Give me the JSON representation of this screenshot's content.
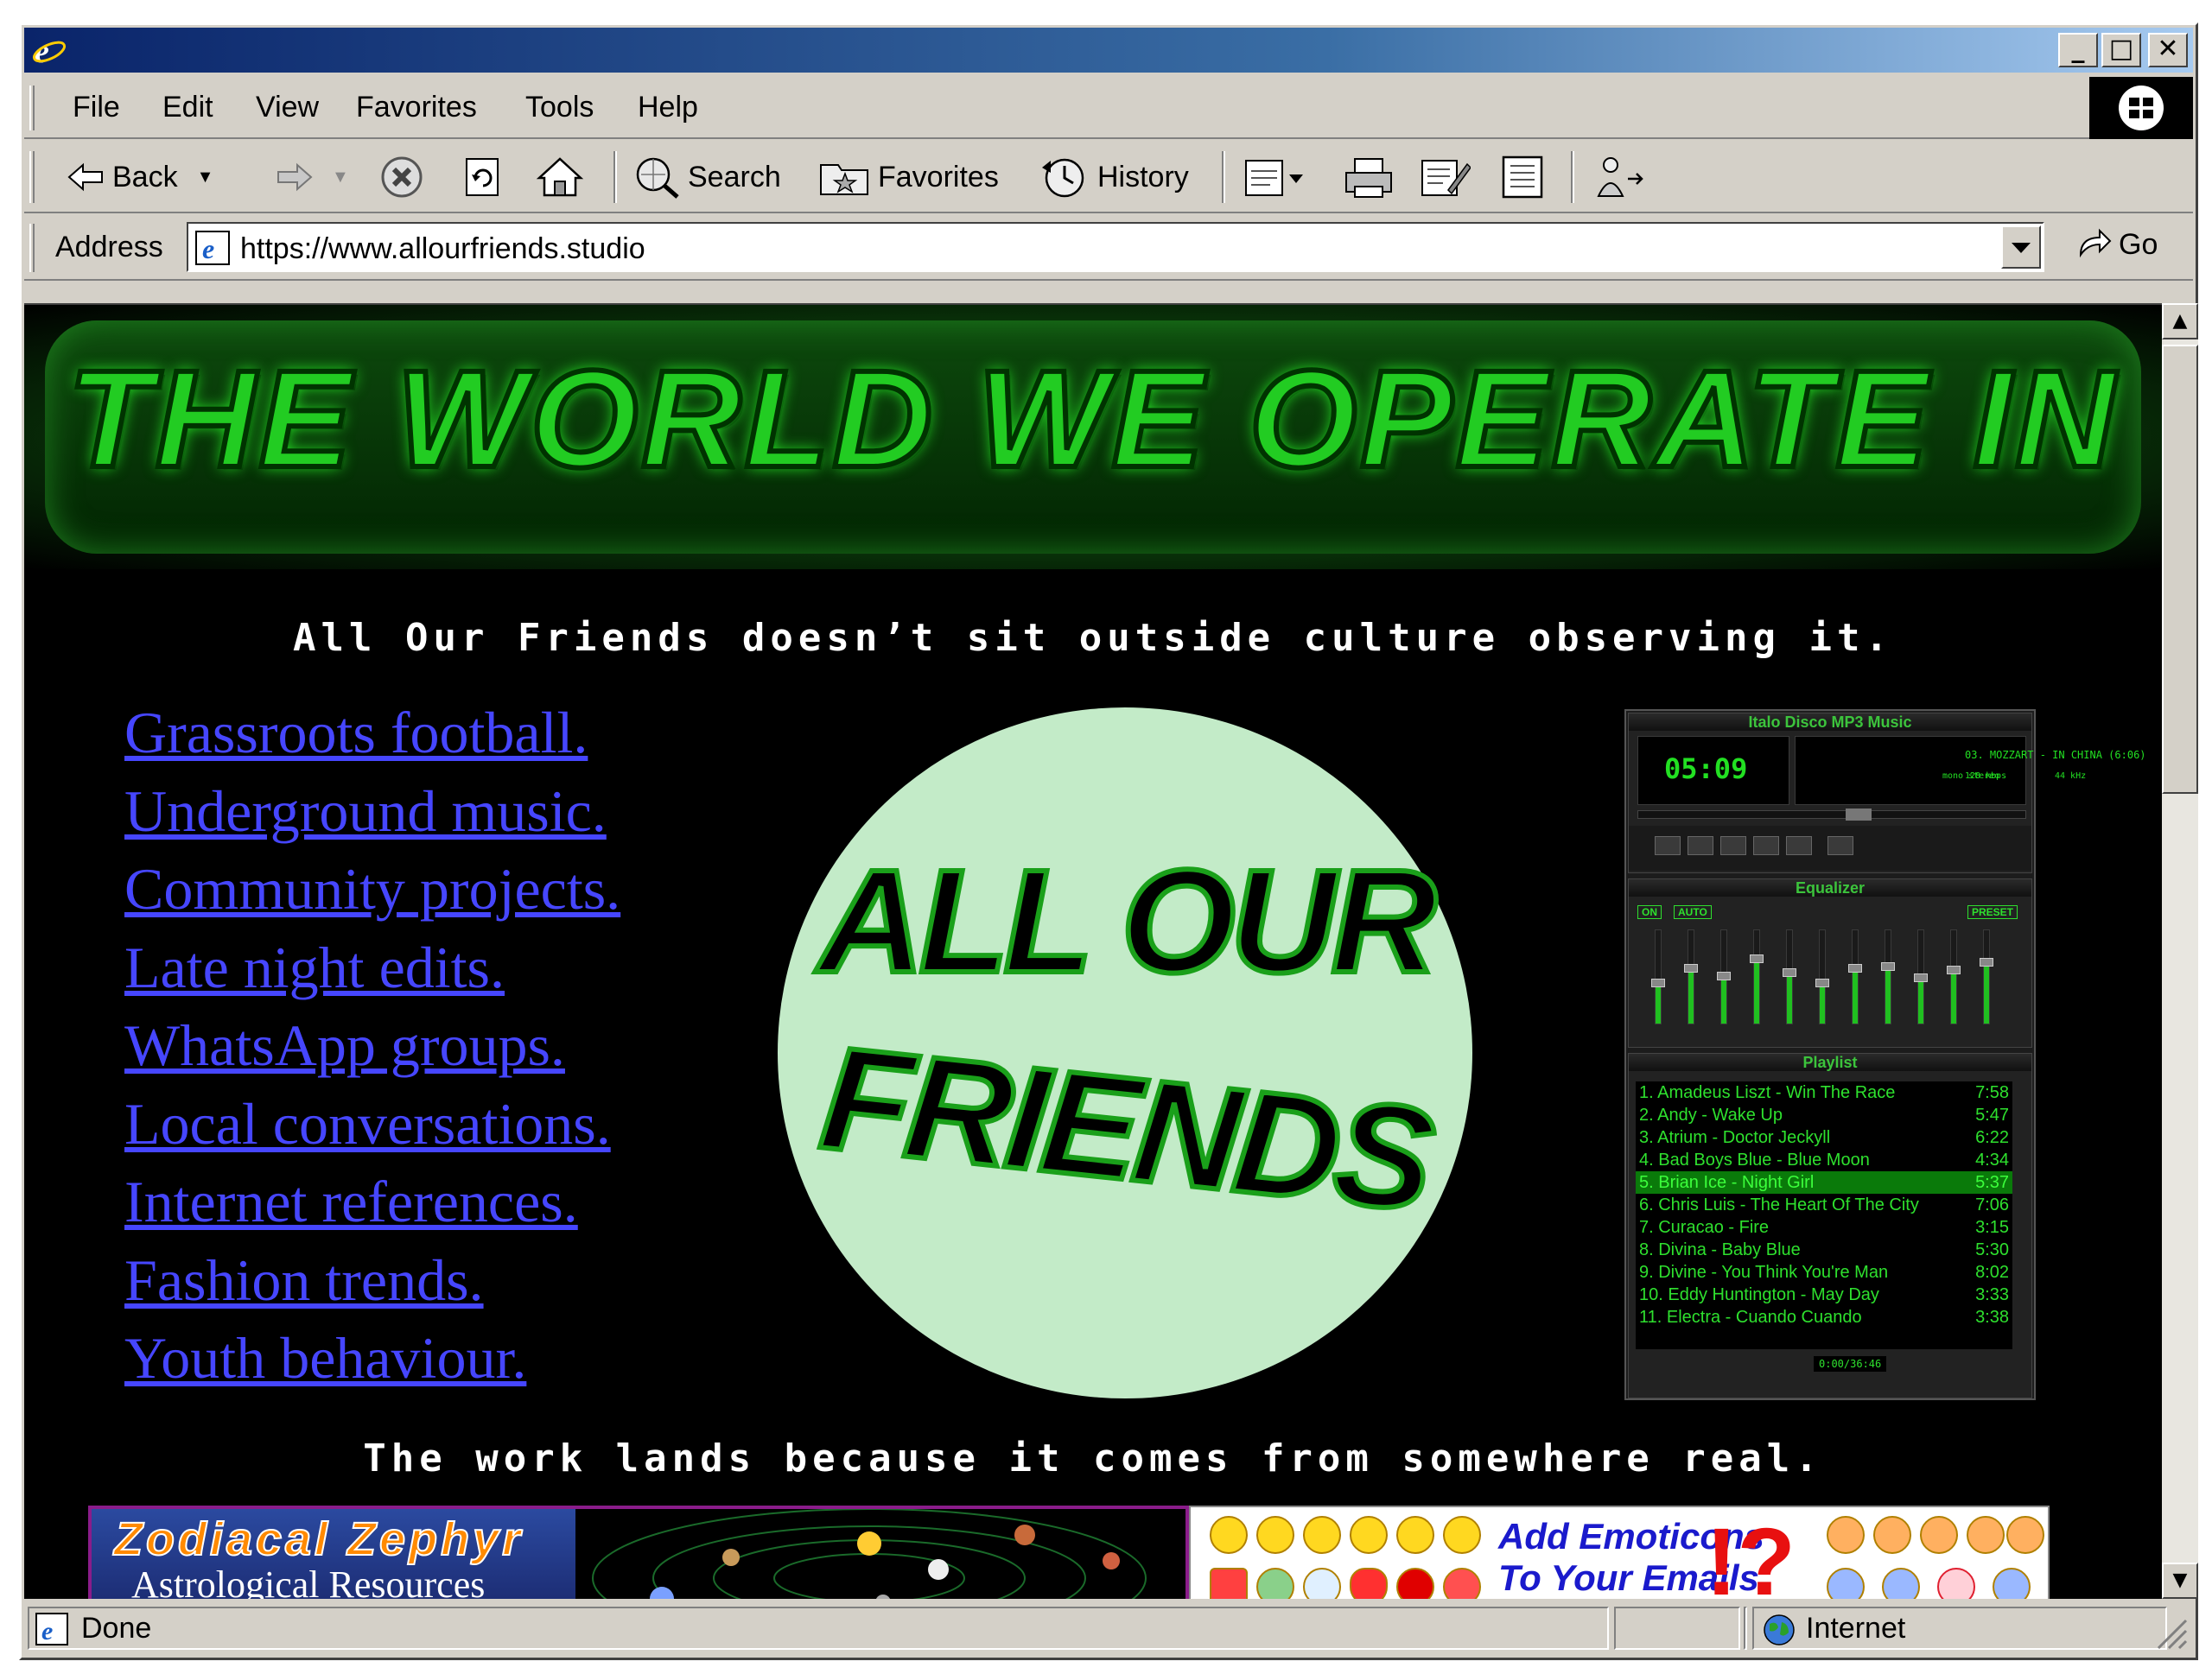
{
  "browser": {
    "menu": [
      "File",
      "Edit",
      "View",
      "Favorites",
      "Tools",
      "Help"
    ],
    "toolbar": {
      "back": "Back",
      "search": "Search",
      "favorites": "Favorites",
      "history": "History"
    },
    "address": {
      "label": "Address",
      "url": "https://www.allourfriends.studio",
      "go": "Go"
    },
    "status": {
      "text": "Done",
      "zone": "Internet"
    }
  },
  "page": {
    "banner_title": "THE WORLD WE OPERATE IN",
    "intro": "All Our Friends doesn’t sit outside culture observing it.",
    "links": [
      "Grassroots football.",
      "Underground music.",
      "Community projects.",
      "Late night edits.",
      "WhatsApp groups.",
      "Local conversations.",
      "Internet references.",
      "Fashion trends.",
      "Youth behaviour."
    ],
    "logo": {
      "line1": "ALL OUR",
      "line2": "FRIENDS"
    },
    "outro": "The work lands because it comes from somewhere real."
  },
  "winamp": {
    "title": "Italo Disco MP3 Music",
    "time": "05:09",
    "song": "03. MOZZART - IN CHINA (6:06)",
    "bitrate": "128 kbps",
    "samplerate": "44 kHz",
    "mode": "mono stereo",
    "eq_title": "Equalizer",
    "eq_on": "ON",
    "eq_auto": "AUTO",
    "eq_preset": "PRESET",
    "eq_levels": [
      0.45,
      0.6,
      0.52,
      0.7,
      0.55,
      0.45,
      0.6,
      0.62,
      0.5,
      0.58,
      0.66
    ],
    "playlist_title": "Playlist",
    "playlist": [
      {
        "title": "1. Amadeus Liszt - Win The Race",
        "dur": "7:58"
      },
      {
        "title": "2. Andy - Wake Up",
        "dur": "5:47"
      },
      {
        "title": "3. Atrium - Doctor Jeckyll",
        "dur": "6:22"
      },
      {
        "title": "4. Bad Boys Blue - Blue Moon",
        "dur": "4:34"
      },
      {
        "title": "5. Brian Ice - Night Girl",
        "dur": "5:37",
        "selected": true
      },
      {
        "title": "6. Chris Luis - The Heart Of The City",
        "dur": "7:06"
      },
      {
        "title": "7. Curacao - Fire",
        "dur": "3:15"
      },
      {
        "title": "8. Divina - Baby Blue",
        "dur": "5:30"
      },
      {
        "title": "9. Divine - You Think You're Man",
        "dur": "8:02"
      },
      {
        "title": "10. Eddy Huntington - May Day",
        "dur": "3:33"
      },
      {
        "title": "11. Electra - Cuando Cuando",
        "dur": "3:38"
      }
    ],
    "pl_time": "0:00/36:46"
  },
  "ads": {
    "zodiacal": {
      "title": "Zodiacal Zephyr",
      "subtitle": "Astrological Resources"
    },
    "emoticons": {
      "line1": "Add Emoticons",
      "line2": "To Your Emails",
      "mark": "!?"
    }
  },
  "colors": {
    "link": "#4646ff",
    "banner_green": "#22cc22",
    "logo_bg": "#c3ebc8",
    "winamp_green": "#22e022"
  }
}
